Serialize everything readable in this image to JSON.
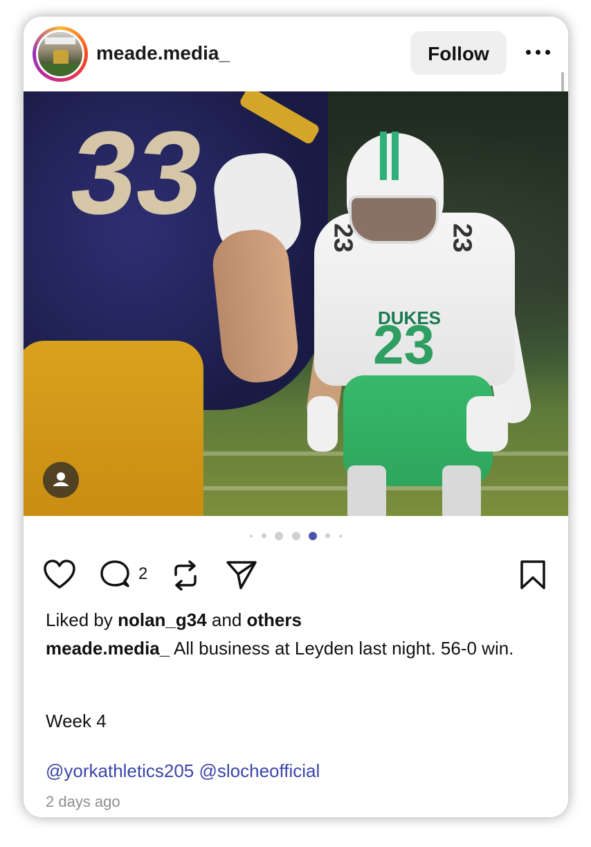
{
  "header": {
    "username": "meade.media_",
    "follow_label": "Follow",
    "more_icon": "more-horizontal-icon"
  },
  "post": {
    "image_alt": "football players",
    "tag_icon": "person-tag-icon",
    "carousel": {
      "total": 7,
      "active_index": 4
    }
  },
  "actions": {
    "like_icon": "heart-icon",
    "comment_icon": "comment-icon",
    "comment_count": "2",
    "repost_icon": "repost-icon",
    "share_icon": "send-icon",
    "save_icon": "bookmark-icon"
  },
  "likes": {
    "prefix": "Liked by ",
    "user": "nolan_g34",
    "middle": " and ",
    "others": "others"
  },
  "caption": {
    "author": "meade.media_",
    "text": " All business at Leyden last night. 56-0 win.",
    "line2": "Week 4",
    "mentions": "@yorkathletics205 @slocheofficial"
  },
  "timestamp": "2 days ago",
  "colors": {
    "accent_mention": "#3a44a8",
    "dot_active": "#4a54b0",
    "follow_bg": "#efefef"
  }
}
